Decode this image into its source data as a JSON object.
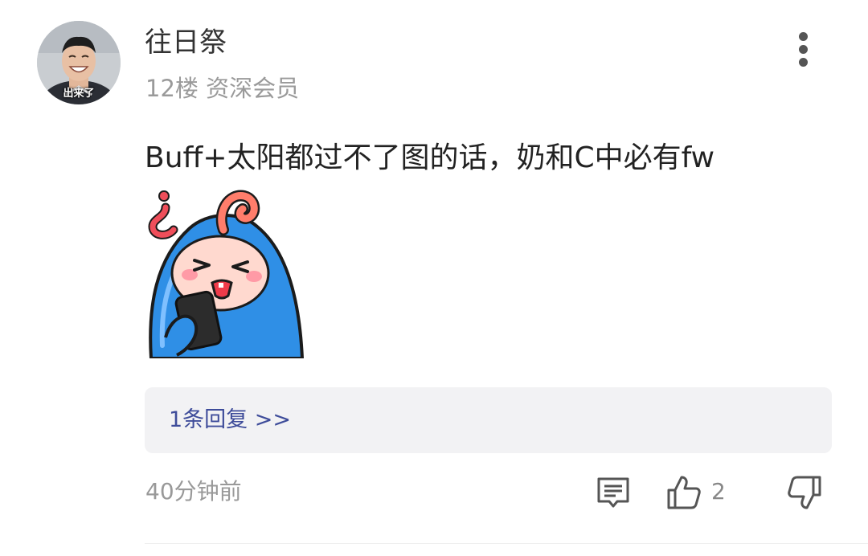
{
  "comment": {
    "avatar_caption": "出来了",
    "username": "往日祭",
    "floor_and_rank": "12楼 资深会员",
    "text": "Buff+太阳都过不了图的话，奶和C中必有fw",
    "sticker_icon": "confused-blue-mascot-phone",
    "reply_link": "1条回复 >>",
    "timestamp": "40分钟前",
    "like_count": "2",
    "icons": {
      "more": "vertical-dots-icon",
      "comment": "comment-icon",
      "like": "thumbs-up-icon",
      "dislike": "thumbs-down-icon"
    },
    "colors": {
      "reply_link": "#3e4c9a",
      "meta_gray": "#9a9a9a",
      "reply_background": "#f2f2f4"
    }
  }
}
